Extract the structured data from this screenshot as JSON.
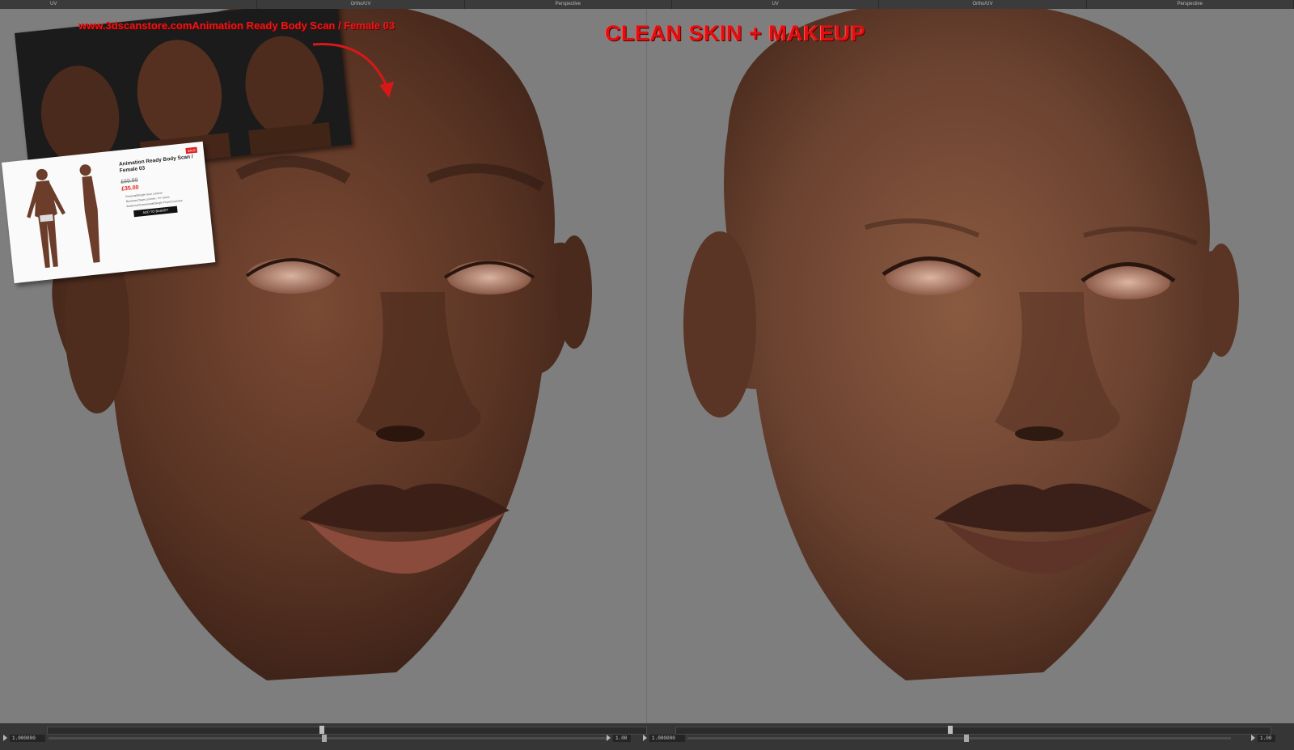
{
  "viewport_tabs": [
    "UV",
    "Ortho/UV",
    "Perspective",
    "UV",
    "Ortho/UV",
    "Perspective"
  ],
  "banner": {
    "title": "CLEAN SKIN + MAKEUP",
    "store_url": "www.3dscanstore.comAnimation Ready Body Scan / Female 03",
    "color": "#e01010"
  },
  "product_card": {
    "badge": "SALE",
    "title": "Animation Ready Body Scan / Female 03",
    "old_price": "£69.99",
    "new_price": "£35.00",
    "options": [
      "Personal/Single User License",
      "Business/Team License - 5+ Users",
      "Business/Commercial/Single Project License"
    ],
    "button": "ADD TO BASKET"
  },
  "timeline_left": {
    "start_value": "1.000000",
    "scale_value": "1.00"
  },
  "timeline_right": {
    "start_value": "1.000000",
    "scale_value": "1.00"
  },
  "colors": {
    "viewport_bg": "#7e7e7e",
    "skin_left": "#5a3424",
    "skin_right": "#6b4230",
    "banner": "#e01010"
  }
}
